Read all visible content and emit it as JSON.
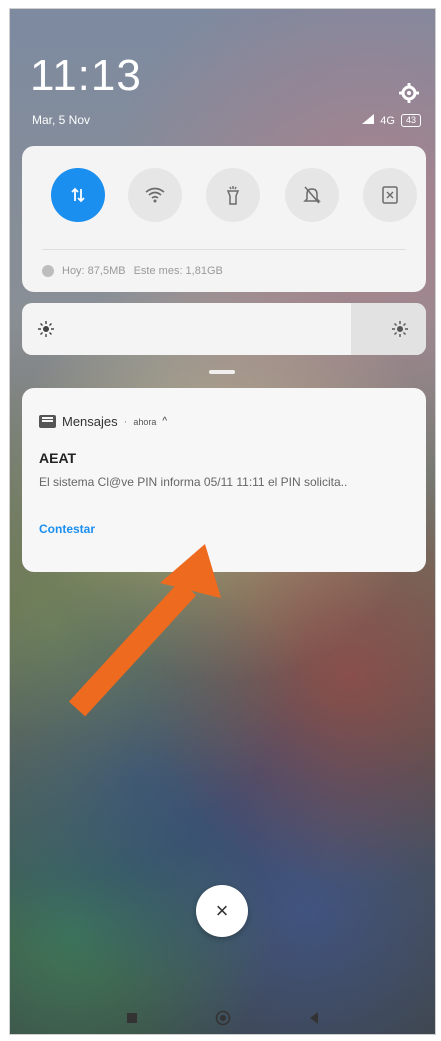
{
  "status": {
    "time": "11:13",
    "date": "Mar, 5 Nov",
    "network": "4G",
    "battery": "43"
  },
  "quick_settings": {
    "toggles": [
      {
        "name": "mobile-data-icon",
        "active": true
      },
      {
        "name": "wifi-icon",
        "active": false
      },
      {
        "name": "flashlight-icon",
        "active": false
      },
      {
        "name": "silent-icon",
        "active": false
      },
      {
        "name": "screenshot-icon",
        "active": false
      }
    ],
    "data_today": "Hoy: 87,5MB",
    "data_month": "Este mes: 1,81GB"
  },
  "notification": {
    "app": "Mensajes",
    "separator": "·",
    "time": "ahora",
    "title": "AEAT",
    "body": "El sistema Cl@ve PIN informa 05/11 11:11 el PIN solicita..",
    "reply_label": "Contestar"
  },
  "close_label": "×",
  "colors": {
    "accent": "#1a8ff0",
    "arrow": "#ee6a1e"
  }
}
